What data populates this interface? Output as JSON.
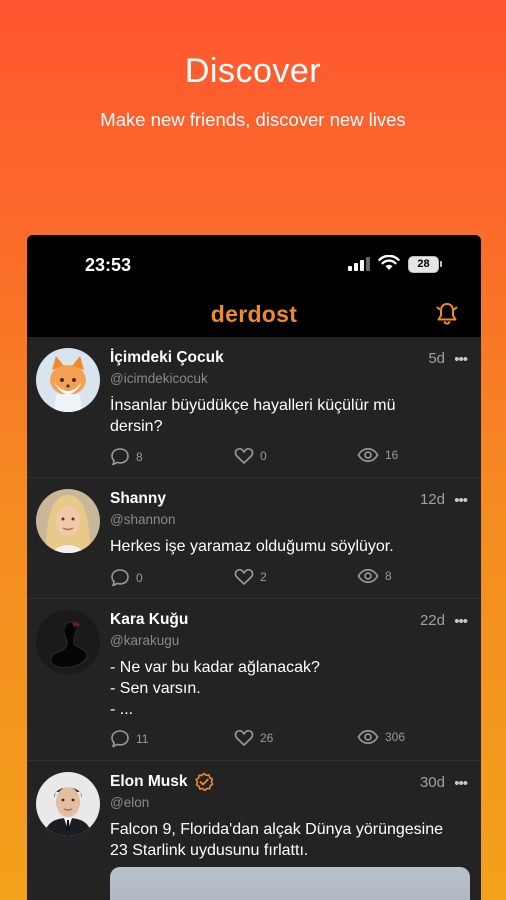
{
  "hero": {
    "title": "Discover",
    "subtitle": "Make new friends, discover new lives"
  },
  "status_bar": {
    "time": "23:53",
    "battery": "28"
  },
  "app": {
    "brand": "derdost"
  },
  "posts": [
    {
      "name": "İçimdeki Çocuk",
      "handle": "@icimdekicocuk",
      "age": "5d",
      "text": "İnsanlar büyüdükçe hayalleri küçülür mü\ndersin?",
      "comments": "8",
      "likes": "0",
      "views": "16",
      "verified": false
    },
    {
      "name": "Shanny",
      "handle": "@shannon",
      "age": "12d",
      "text": "Herkes işe yaramaz olduğumu söylüyor.",
      "comments": "0",
      "likes": "2",
      "views": "8",
      "verified": false
    },
    {
      "name": "Kara Kuğu",
      "handle": "@karakugu",
      "age": "22d",
      "text": "- Ne var bu kadar ağlanacak?\n- Sen varsın.\n- ...",
      "comments": "11",
      "likes": "26",
      "views": "306",
      "verified": false
    },
    {
      "name": "Elon Musk",
      "handle": "@elon",
      "age": "30d",
      "text": "Falcon 9, Florida'dan alçak Dünya yörüngesine\n23 Starlink uydusunu fırlattı.",
      "verified": true
    }
  ],
  "icons": {
    "comment": "comment-bubble-icon",
    "like": "heart-icon",
    "views": "eye-icon",
    "more": "more-dots-icon",
    "bell": "bell-icon",
    "verified": "verified-badge-icon"
  },
  "colors": {
    "accent": "#f08a26",
    "background_top": "#ff5630",
    "background_bottom": "#f3a11b",
    "card": "#232323"
  }
}
